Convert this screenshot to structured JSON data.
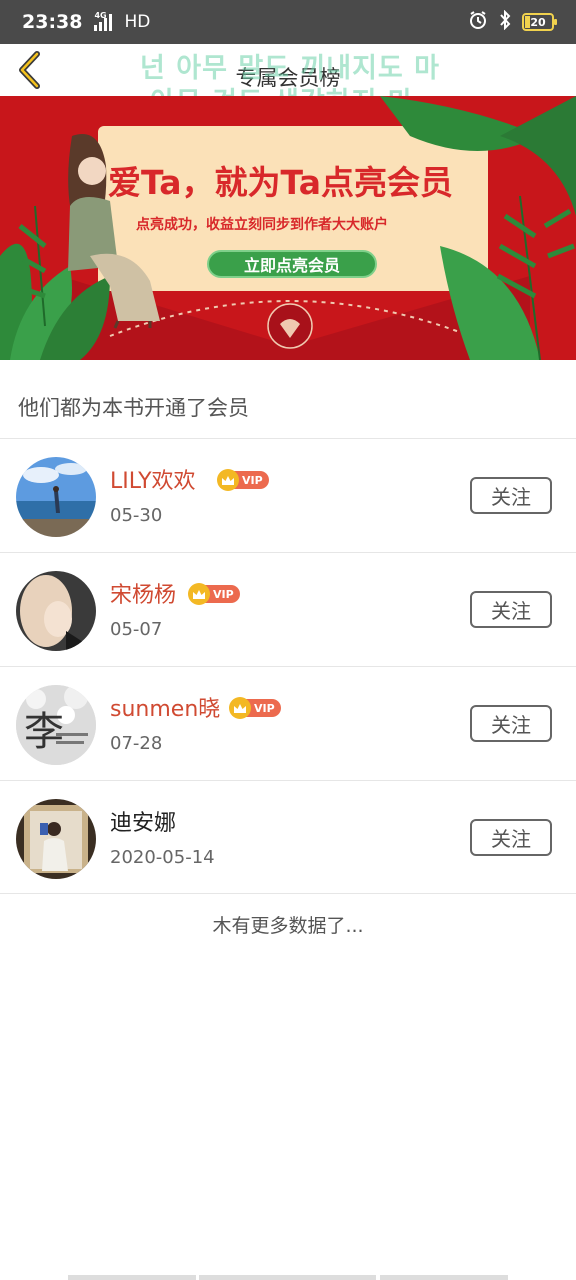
{
  "status_bar": {
    "time": "23:38",
    "network": "4G",
    "hd_label": "HD",
    "battery": "20",
    "icons": [
      "alarm-icon",
      "bluetooth-icon",
      "battery-icon"
    ]
  },
  "header": {
    "title": "专属会员榜",
    "back_icon": "chevron-left-icon"
  },
  "overlay": {
    "line1": "넌 아무 말도 끼내지도 마",
    "line2": "아무 것도 생각하지 마"
  },
  "banner": {
    "headline": "爱Ta，就为Ta点亮会员",
    "subtitle": "点亮成功，收益立刻同步到作者大大账户",
    "button_label": "立即点亮会员",
    "colors": {
      "background": "#c8161b",
      "card": "#fbe1b8",
      "button": "#3aa04a"
    }
  },
  "section": {
    "title": "他们都为本书开通了会员"
  },
  "members": [
    {
      "name": "LILY欢欢",
      "date": "05-30",
      "vip": true,
      "vip_label": "VIP",
      "follow_label": "关注"
    },
    {
      "name": "宋杨杨",
      "date": "05-07",
      "vip": true,
      "vip_label": "VIP",
      "follow_label": "关注"
    },
    {
      "name": "sunmen晓",
      "date": "07-28",
      "vip": true,
      "vip_label": "VIP",
      "follow_label": "关注"
    },
    {
      "name": "迪安娜",
      "date": "2020-05-14",
      "vip": false,
      "follow_label": "关注"
    }
  ],
  "avatar_text": {
    "member_3_char": "李"
  },
  "footer": {
    "no_more_text": "木有更多数据了..."
  },
  "colors": {
    "vip_name": "#d04a32",
    "vip_badge": "#ec6a4e",
    "crown": "#f3b824"
  }
}
